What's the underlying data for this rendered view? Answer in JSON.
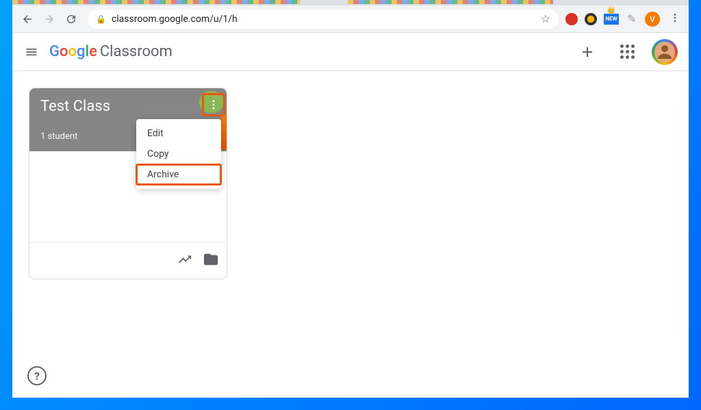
{
  "browser": {
    "url": "classroom.google.com/u/1/h",
    "avatar_initial": "V",
    "new_badge": "NEW"
  },
  "header": {
    "logo_prefix_chars": [
      "G",
      "o",
      "o",
      "g",
      "l",
      "e"
    ],
    "logo_suffix": "Classroom"
  },
  "class_card": {
    "title": "Test Class",
    "student_count_text": "1 student"
  },
  "dropdown": {
    "items": [
      {
        "label": "Edit",
        "highlight": false
      },
      {
        "label": "Copy",
        "highlight": false
      },
      {
        "label": "Archive",
        "highlight": true
      }
    ]
  },
  "help_label": "?"
}
